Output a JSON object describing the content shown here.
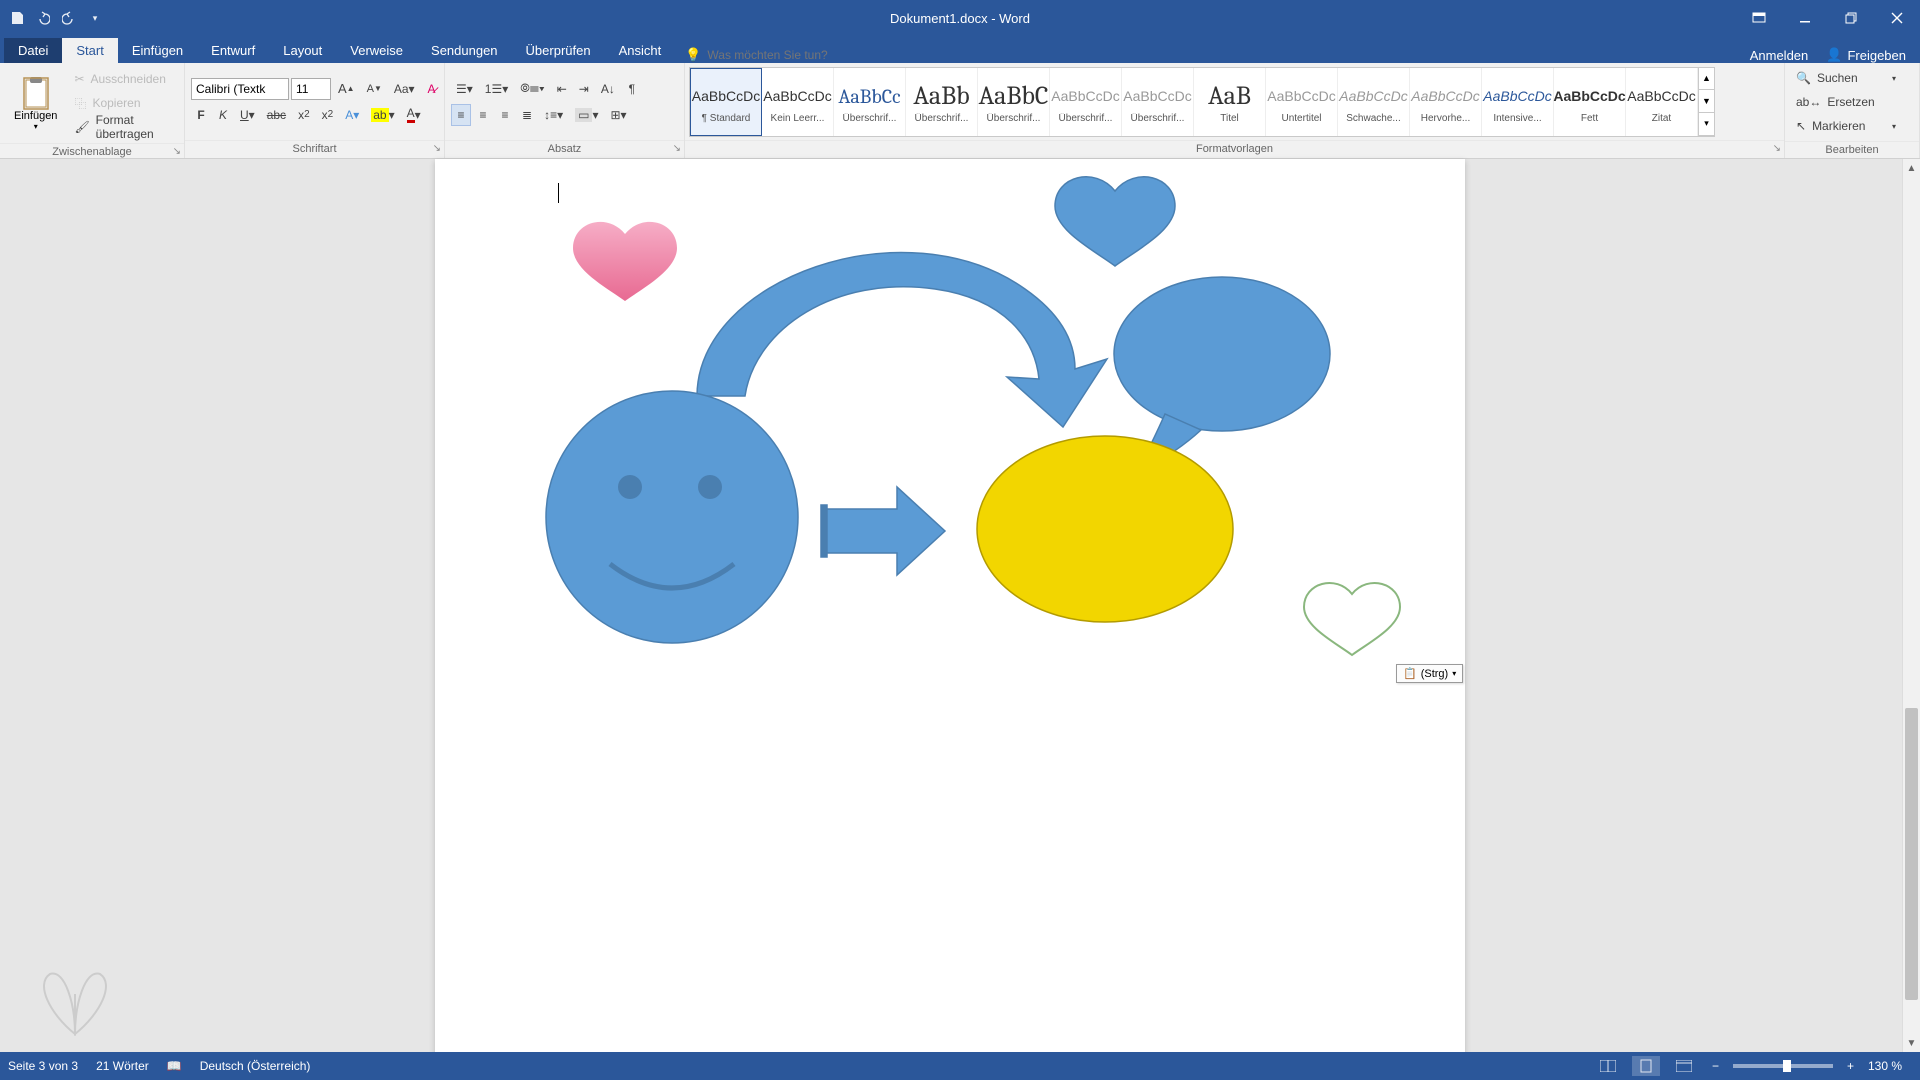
{
  "title": "Dokument1.docx - Word",
  "tabs": {
    "file": "Datei",
    "start": "Start",
    "einfuegen": "Einfügen",
    "entwurf": "Entwurf",
    "layout": "Layout",
    "verweise": "Verweise",
    "sendungen": "Sendungen",
    "ueberpruefen": "Überprüfen",
    "ansicht": "Ansicht"
  },
  "tell_me_placeholder": "Was möchten Sie tun?",
  "account": {
    "anmelden": "Anmelden",
    "freigeben": "Freigeben"
  },
  "clipboard": {
    "einfuegen": "Einfügen",
    "ausschneiden": "Ausschneiden",
    "kopieren": "Kopieren",
    "format_uebertragen": "Format übertragen",
    "group": "Zwischenablage"
  },
  "font": {
    "name": "Calibri (Textk",
    "size": "11",
    "group": "Schriftart"
  },
  "paragraph": {
    "group": "Absatz"
  },
  "styles": {
    "group": "Formatvorlagen",
    "sample": "AaBbCcDc",
    "items": [
      {
        "preview": "AaBbCcDc",
        "cls": "",
        "name": "¶ Standard"
      },
      {
        "preview": "AaBbCcDc",
        "cls": "",
        "name": "Kein Leerr..."
      },
      {
        "preview": "AaBbCc",
        "cls": "h1",
        "name": "Überschrif..."
      },
      {
        "preview": "AaBb",
        "cls": "big",
        "name": "Überschrif..."
      },
      {
        "preview": "AaBbC",
        "cls": "big",
        "name": "Überschrif..."
      },
      {
        "preview": "AaBbCcDc",
        "cls": "sub",
        "name": "Überschrif..."
      },
      {
        "preview": "AaBbCcDc",
        "cls": "sub",
        "name": "Überschrif..."
      },
      {
        "preview": "AaB",
        "cls": "big",
        "name": "Titel"
      },
      {
        "preview": "AaBbCcDc",
        "cls": "sub",
        "name": "Untertitel"
      },
      {
        "preview": "AaBbCcDc",
        "cls": "em",
        "name": "Schwache..."
      },
      {
        "preview": "AaBbCcDc",
        "cls": "em",
        "name": "Hervorhe..."
      },
      {
        "preview": "AaBbCcDc",
        "cls": "int",
        "name": "Intensive..."
      },
      {
        "preview": "AaBbCcDc",
        "cls": "bold",
        "name": "Fett"
      },
      {
        "preview": "AaBbCcDc",
        "cls": "",
        "name": "Zitat"
      }
    ]
  },
  "editing": {
    "group": "Bearbeiten",
    "suchen": "Suchen",
    "ersetzen": "Ersetzen",
    "markieren": "Markieren"
  },
  "paste_tag": "(Strg)",
  "status": {
    "page": "Seite 3 von 3",
    "words": "21 Wörter",
    "lang": "Deutsch (Österreich)",
    "zoom": "130 %"
  },
  "colors": {
    "accent": "#5b9bd5",
    "accent_dark": "#4a7fb0",
    "yellow": "#f2d600",
    "pink_light": "#f6adc6",
    "pink_dark": "#e86a92",
    "green": "#8ab77e"
  }
}
